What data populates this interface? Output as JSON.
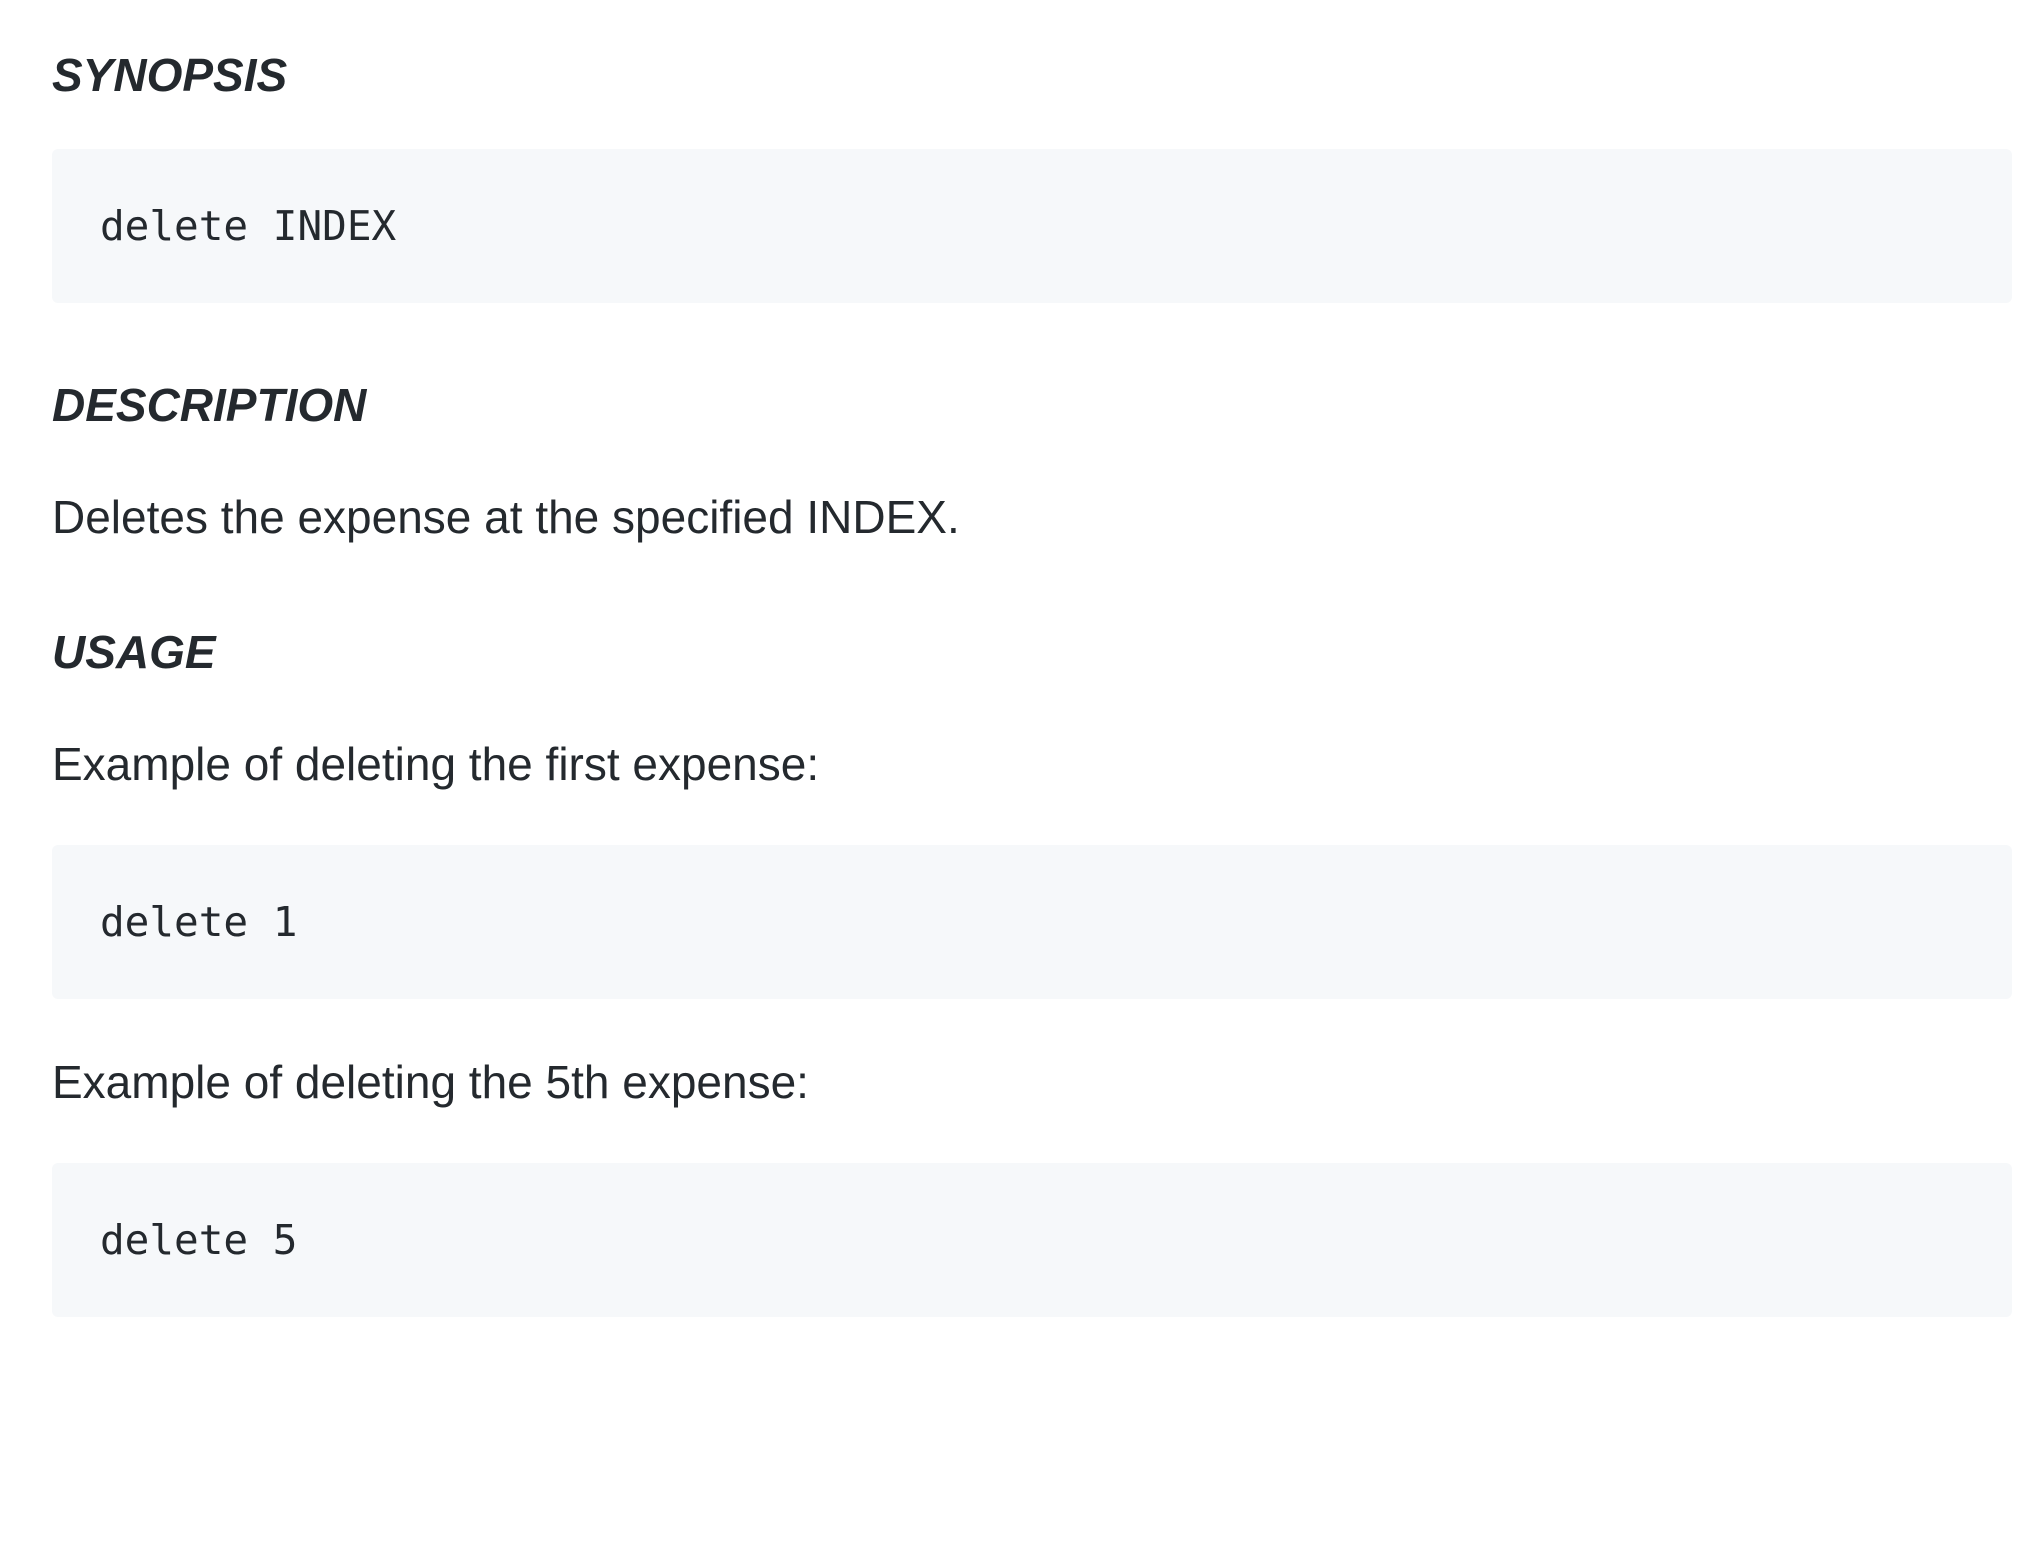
{
  "synopsis": {
    "heading": "SYNOPSIS",
    "code": "delete INDEX"
  },
  "description": {
    "heading": "DESCRIPTION",
    "text": "Deletes the expense at the specified INDEX."
  },
  "usage": {
    "heading": "USAGE",
    "examples": [
      {
        "caption": "Example of deleting the first expense:",
        "code": "delete 1"
      },
      {
        "caption": "Example of deleting the 5th expense:",
        "code": "delete 5"
      }
    ]
  },
  "colors": {
    "text": "#24292e",
    "code_background": "#f6f8fa",
    "page_background": "#ffffff"
  }
}
